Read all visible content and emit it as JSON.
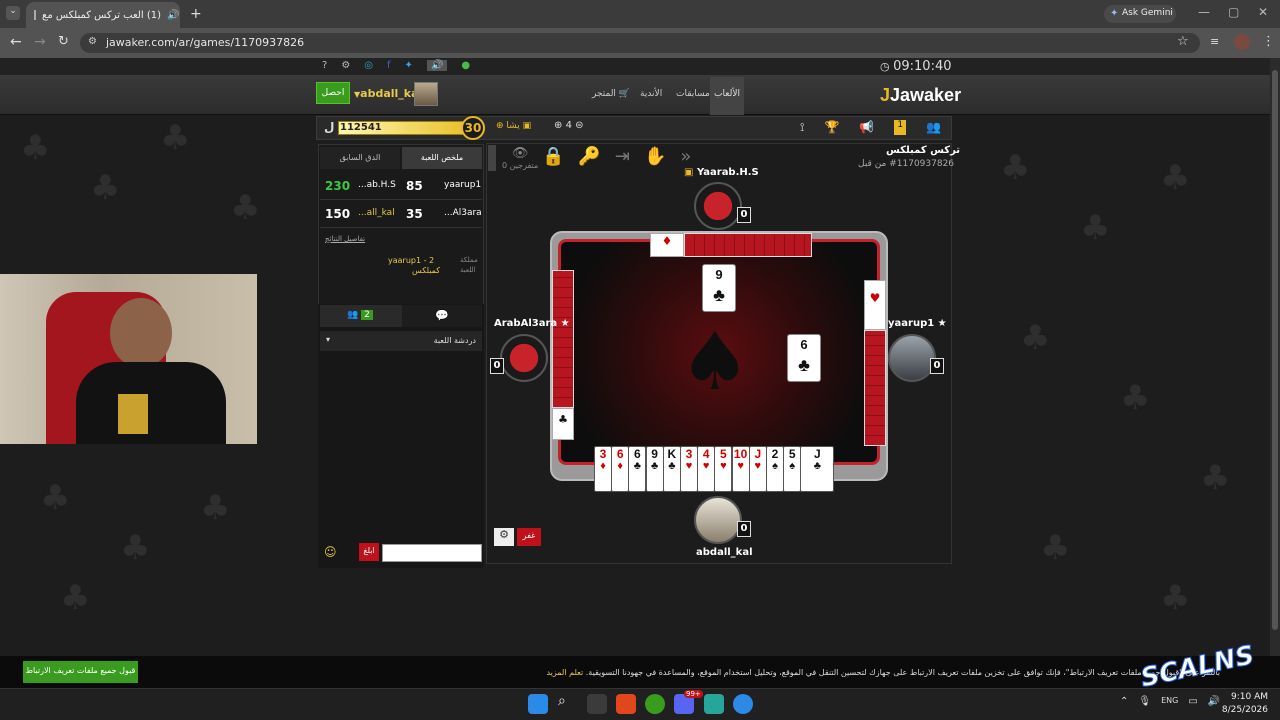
{
  "browser": {
    "tab_title": "(1) العب تركس كمبلكس مع",
    "url": "jawaker.com/ar/games/1170937826",
    "gemini": "Ask Gemini"
  },
  "site": {
    "clock": "09:10:40",
    "logo": "Jawaker",
    "nav": {
      "games": "الألعاب",
      "competitions": "مسابقات",
      "clubs": "الأندية",
      "store": "المتجر"
    },
    "get_button": "احصل",
    "username": "abdall_kal",
    "coins": "112541",
    "level": "30",
    "badge_count": "1",
    "counter": "4",
    "bag_label": "يشا"
  },
  "left_panel": {
    "tab_summary": "ملخص اللعبة",
    "tab_previous": "الدق السابق",
    "scores": [
      {
        "team_a": "yaarup1",
        "score_a": "85",
        "team_b": "...ab.H.S",
        "score_b": "230"
      },
      {
        "team_a": "...Al3ara",
        "score_a": "35",
        "team_b": "...all_kal",
        "score_b": "150"
      }
    ],
    "details_link": "تفاصيل النتائج",
    "kingdom_label": "مملكة",
    "game_label": "اللعبة",
    "kingdom_value": "yaarup1 - 2",
    "game_value": "كمبلكس",
    "online_count": "2",
    "chat_header": "دردشة اللعبة",
    "send_button": "ابلغ"
  },
  "game": {
    "title": "تركس كمبلكس",
    "id_line": "#1170937826 من قبل",
    "spectators": "0 متفرجين",
    "players": {
      "top": {
        "name": "Yaarab.H.S",
        "score": "0"
      },
      "left": {
        "name": "ArabAl3ara",
        "score": "0"
      },
      "right": {
        "name": "yaarup1",
        "score": "0"
      },
      "bottom": {
        "name": "abdall_kal",
        "score": "0"
      }
    },
    "played_cards": [
      {
        "rank": "9",
        "suit": "♣"
      },
      {
        "rank": "6",
        "suit": "♣"
      }
    ],
    "hand": [
      {
        "rank": "3",
        "suit": "♦",
        "color": "red"
      },
      {
        "rank": "6",
        "suit": "♦",
        "color": "red"
      },
      {
        "rank": "6",
        "suit": "♣",
        "color": "black"
      },
      {
        "rank": "9",
        "suit": "♣",
        "color": "black"
      },
      {
        "rank": "K",
        "suit": "♣",
        "color": "black"
      },
      {
        "rank": "3",
        "suit": "♥",
        "color": "red"
      },
      {
        "rank": "4",
        "suit": "♥",
        "color": "red"
      },
      {
        "rank": "5",
        "suit": "♥",
        "color": "red"
      },
      {
        "rank": "10",
        "suit": "♥",
        "color": "red"
      },
      {
        "rank": "J",
        "suit": "♥",
        "color": "red"
      },
      {
        "rank": "2",
        "suit": "♠",
        "color": "black"
      },
      {
        "rank": "5",
        "suit": "♠",
        "color": "black"
      },
      {
        "rank": "J",
        "suit": "♣",
        "color": "black"
      }
    ],
    "forfeit_button": "غفر"
  },
  "cookie": {
    "accept_button": "قبول جميع ملفات تعريف الارتباط",
    "text": "بالنقر على \"قبول جميع ملفات تعريف الارتباط\"، فإنك توافق على تخزين ملفات تعريف الارتباط على جهازك لتحسين التنقل في الموقع، وتحليل استخدام الموقع، والمساعدة في جهودنا التسويقية.",
    "learn_more": "تعلم المزيد"
  },
  "watermark": "SCALNS",
  "taskbar": {
    "lang": "ENG",
    "time": "9:10 AM",
    "date": "8/25/2026",
    "badge": "99+"
  },
  "colors": {
    "accent_red": "#c7222b",
    "green": "#3a9c1e",
    "gold": "#e8b923"
  }
}
